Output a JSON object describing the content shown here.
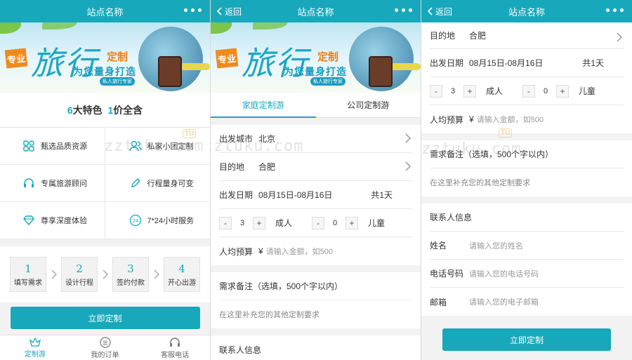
{
  "site_title": "站点名称",
  "back_label": "返回",
  "banner": {
    "tag": "专业",
    "big": "旅行",
    "dz": "定制",
    "sub": "为您量身打造",
    "pill": "私人旅行专家"
  },
  "home": {
    "features_heading": {
      "n1": "6",
      "t1": "大特色  ",
      "n2": "1",
      "t2": "价全含"
    },
    "features": [
      {
        "icon": "grid-icon",
        "label": "甄选品质资源"
      },
      {
        "icon": "users-icon",
        "label": "私家小团定制"
      },
      {
        "icon": "headset-icon",
        "label": "专属旅游顾问"
      },
      {
        "icon": "pencil-icon",
        "label": "行程量身可变"
      },
      {
        "icon": "diamond-icon",
        "label": "尊享深度体验"
      },
      {
        "icon": "clock-24-icon",
        "label": "7*24小时服务"
      }
    ],
    "steps": [
      {
        "n": "1",
        "t": "填写需求"
      },
      {
        "n": "2",
        "t": "设计行程"
      },
      {
        "n": "3",
        "t": "签约付款"
      },
      {
        "n": "4",
        "t": "开心出游"
      }
    ],
    "cta": "立即定制",
    "tabs": [
      {
        "icon": "crown-icon",
        "label": "定制游",
        "active": true
      },
      {
        "icon": "list-icon",
        "label": "我的订单",
        "active": false
      },
      {
        "icon": "headset-icon",
        "label": "客服电话",
        "active": false
      }
    ]
  },
  "form": {
    "tab_family": "家庭定制游",
    "tab_company": "公司定制游",
    "depart_city_label": "出发城市",
    "depart_city_value": "北京",
    "destination_label": "目的地",
    "destination_value": "合肥",
    "date_label": "出发日期",
    "date_value": "08月15日-08月16日",
    "total_days": "共1天",
    "adults_value": "3",
    "adults_label": "成人",
    "children_value": "0",
    "children_label": "儿童",
    "minus": "-",
    "plus": "+",
    "budget_label": "人均预算",
    "budget_currency": "¥",
    "budget_placeholder": "请输入金额，如500",
    "notes_label": "需求备注（选填，500个字以内）",
    "notes_placeholder": "在这里补充您的其他定制要求",
    "contact_heading": "联系人信息",
    "name_label": "姓名",
    "name_placeholder": "请输入您的姓名",
    "phone_label": "电话号码",
    "phone_placeholder": "请输入您的电话号码",
    "email_label": "邮箱",
    "email_placeholder": "请输入您的电子邮箱",
    "submit": "立即定制"
  },
  "watermark": {
    "text": "zztuku.com",
    "badge": "TU"
  },
  "colors": {
    "accent": "#17a9bb",
    "orange": "#f08a1c"
  }
}
